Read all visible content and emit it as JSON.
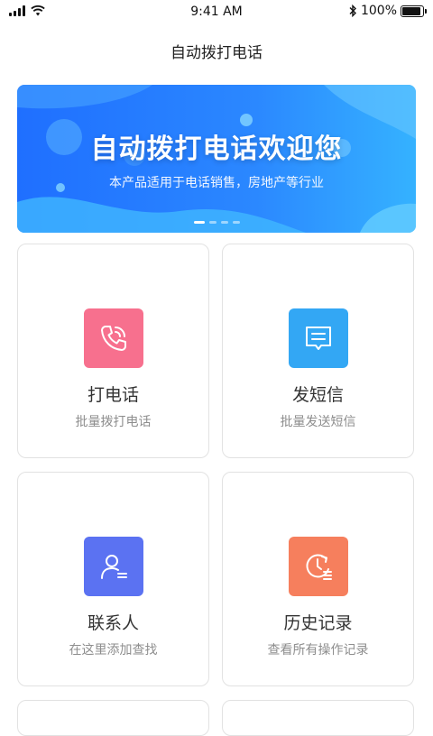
{
  "status_bar": {
    "time": "9:41 AM",
    "battery": "100%",
    "battery_level": 1.0
  },
  "nav": {
    "title": "自动拨打电话"
  },
  "banner": {
    "title": "自动拨打电话欢迎您",
    "subtitle": "本产品适用于电话销售，房地产等行业",
    "page_index": 0,
    "page_count": 4
  },
  "cards": [
    {
      "title": "打电话",
      "subtitle": "批量拨打电话",
      "icon": "phone-icon",
      "color": "#f7708e"
    },
    {
      "title": "发短信",
      "subtitle": "批量发送短信",
      "icon": "message-icon",
      "color": "#33a7f4"
    },
    {
      "title": "联系人",
      "subtitle": "在这里添加查找",
      "icon": "contact-icon",
      "color": "#5b72f2"
    },
    {
      "title": "历史记录",
      "subtitle": "查看所有操作记录",
      "icon": "history-icon",
      "color": "#f67f5d"
    }
  ]
}
